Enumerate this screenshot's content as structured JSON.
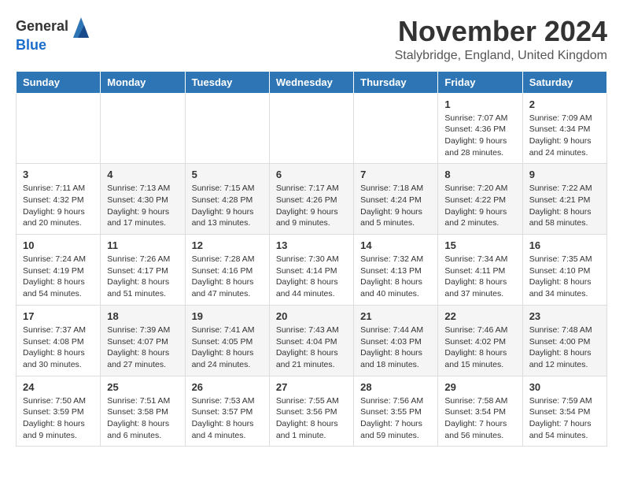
{
  "logo": {
    "general": "General",
    "blue": "Blue"
  },
  "title": "November 2024",
  "location": "Stalybridge, England, United Kingdom",
  "weekdays": [
    "Sunday",
    "Monday",
    "Tuesday",
    "Wednesday",
    "Thursday",
    "Friday",
    "Saturday"
  ],
  "weeks": [
    [
      {
        "day": "",
        "info": ""
      },
      {
        "day": "",
        "info": ""
      },
      {
        "day": "",
        "info": ""
      },
      {
        "day": "",
        "info": ""
      },
      {
        "day": "",
        "info": ""
      },
      {
        "day": "1",
        "info": "Sunrise: 7:07 AM\nSunset: 4:36 PM\nDaylight: 9 hours\nand 28 minutes."
      },
      {
        "day": "2",
        "info": "Sunrise: 7:09 AM\nSunset: 4:34 PM\nDaylight: 9 hours\nand 24 minutes."
      }
    ],
    [
      {
        "day": "3",
        "info": "Sunrise: 7:11 AM\nSunset: 4:32 PM\nDaylight: 9 hours\nand 20 minutes."
      },
      {
        "day": "4",
        "info": "Sunrise: 7:13 AM\nSunset: 4:30 PM\nDaylight: 9 hours\nand 17 minutes."
      },
      {
        "day": "5",
        "info": "Sunrise: 7:15 AM\nSunset: 4:28 PM\nDaylight: 9 hours\nand 13 minutes."
      },
      {
        "day": "6",
        "info": "Sunrise: 7:17 AM\nSunset: 4:26 PM\nDaylight: 9 hours\nand 9 minutes."
      },
      {
        "day": "7",
        "info": "Sunrise: 7:18 AM\nSunset: 4:24 PM\nDaylight: 9 hours\nand 5 minutes."
      },
      {
        "day": "8",
        "info": "Sunrise: 7:20 AM\nSunset: 4:22 PM\nDaylight: 9 hours\nand 2 minutes."
      },
      {
        "day": "9",
        "info": "Sunrise: 7:22 AM\nSunset: 4:21 PM\nDaylight: 8 hours\nand 58 minutes."
      }
    ],
    [
      {
        "day": "10",
        "info": "Sunrise: 7:24 AM\nSunset: 4:19 PM\nDaylight: 8 hours\nand 54 minutes."
      },
      {
        "day": "11",
        "info": "Sunrise: 7:26 AM\nSunset: 4:17 PM\nDaylight: 8 hours\nand 51 minutes."
      },
      {
        "day": "12",
        "info": "Sunrise: 7:28 AM\nSunset: 4:16 PM\nDaylight: 8 hours\nand 47 minutes."
      },
      {
        "day": "13",
        "info": "Sunrise: 7:30 AM\nSunset: 4:14 PM\nDaylight: 8 hours\nand 44 minutes."
      },
      {
        "day": "14",
        "info": "Sunrise: 7:32 AM\nSunset: 4:13 PM\nDaylight: 8 hours\nand 40 minutes."
      },
      {
        "day": "15",
        "info": "Sunrise: 7:34 AM\nSunset: 4:11 PM\nDaylight: 8 hours\nand 37 minutes."
      },
      {
        "day": "16",
        "info": "Sunrise: 7:35 AM\nSunset: 4:10 PM\nDaylight: 8 hours\nand 34 minutes."
      }
    ],
    [
      {
        "day": "17",
        "info": "Sunrise: 7:37 AM\nSunset: 4:08 PM\nDaylight: 8 hours\nand 30 minutes."
      },
      {
        "day": "18",
        "info": "Sunrise: 7:39 AM\nSunset: 4:07 PM\nDaylight: 8 hours\nand 27 minutes."
      },
      {
        "day": "19",
        "info": "Sunrise: 7:41 AM\nSunset: 4:05 PM\nDaylight: 8 hours\nand 24 minutes."
      },
      {
        "day": "20",
        "info": "Sunrise: 7:43 AM\nSunset: 4:04 PM\nDaylight: 8 hours\nand 21 minutes."
      },
      {
        "day": "21",
        "info": "Sunrise: 7:44 AM\nSunset: 4:03 PM\nDaylight: 8 hours\nand 18 minutes."
      },
      {
        "day": "22",
        "info": "Sunrise: 7:46 AM\nSunset: 4:02 PM\nDaylight: 8 hours\nand 15 minutes."
      },
      {
        "day": "23",
        "info": "Sunrise: 7:48 AM\nSunset: 4:00 PM\nDaylight: 8 hours\nand 12 minutes."
      }
    ],
    [
      {
        "day": "24",
        "info": "Sunrise: 7:50 AM\nSunset: 3:59 PM\nDaylight: 8 hours\nand 9 minutes."
      },
      {
        "day": "25",
        "info": "Sunrise: 7:51 AM\nSunset: 3:58 PM\nDaylight: 8 hours\nand 6 minutes."
      },
      {
        "day": "26",
        "info": "Sunrise: 7:53 AM\nSunset: 3:57 PM\nDaylight: 8 hours\nand 4 minutes."
      },
      {
        "day": "27",
        "info": "Sunrise: 7:55 AM\nSunset: 3:56 PM\nDaylight: 8 hours\nand 1 minute."
      },
      {
        "day": "28",
        "info": "Sunrise: 7:56 AM\nSunset: 3:55 PM\nDaylight: 7 hours\nand 59 minutes."
      },
      {
        "day": "29",
        "info": "Sunrise: 7:58 AM\nSunset: 3:54 PM\nDaylight: 7 hours\nand 56 minutes."
      },
      {
        "day": "30",
        "info": "Sunrise: 7:59 AM\nSunset: 3:54 PM\nDaylight: 7 hours\nand 54 minutes."
      }
    ]
  ]
}
